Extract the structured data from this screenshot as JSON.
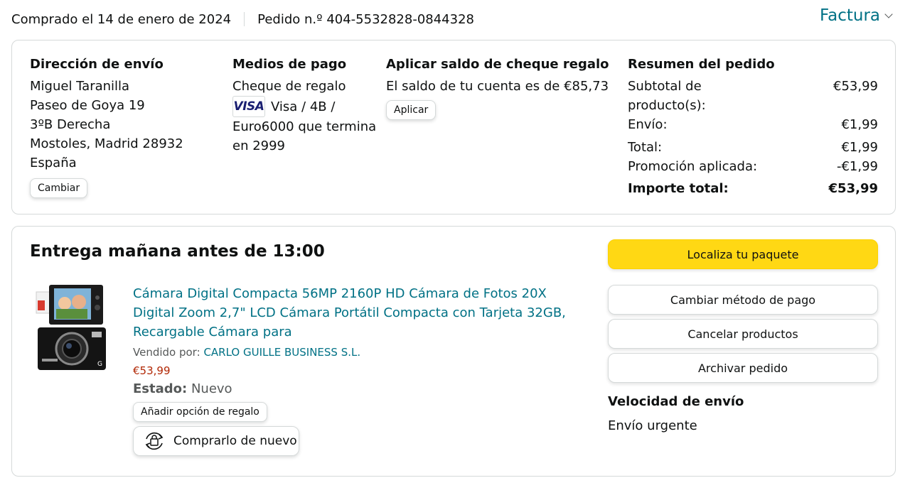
{
  "header": {
    "purchased": "Comprado el 14 de enero de 2024",
    "order_number": "Pedido n.º 404-5532828-0844328",
    "invoice": "Factura"
  },
  "shipping": {
    "heading": "Dirección de envío",
    "lines": [
      "Miguel Taranilla",
      "Paseo de Goya 19",
      "3ºB Derecha",
      "Mostoles, Madrid 28932",
      "España"
    ],
    "change_button": "Cambiar"
  },
  "payment": {
    "heading": "Medios de pago",
    "gift_card": "Cheque de regalo",
    "visa_logo": "VISA",
    "card_text": "Visa / 4B /",
    "card_text2": "Euro6000  que termina en 2999"
  },
  "gift_balance": {
    "heading": "Aplicar saldo de cheque regalo",
    "text": "El saldo de tu cuenta es de €85,73",
    "apply_button": "Aplicar"
  },
  "summary": {
    "heading": "Resumen del pedido",
    "rows": [
      {
        "label": "Subtotal de producto(s):",
        "value": "€53,99"
      },
      {
        "label": "Envío:",
        "value": "€1,99"
      },
      {
        "label": "Total:",
        "value": "€1,99"
      },
      {
        "label": "Promoción aplicada:",
        "value": "-€1,99"
      }
    ],
    "total_label": "Importe total:",
    "total_value": "€53,99"
  },
  "delivery": {
    "title": "Entrega mañana antes de 13:00",
    "product_title": "Cámara Digital Compacta 56MP 2160P HD Cámara de Fotos 20X Digital Zoom 2,7\" LCD Cámara Portátil Compacta con Tarjeta 32GB, Recargable Cámara para",
    "sold_by_label": "Vendido por:",
    "seller": "CARLO GUILLE BUSINESS S.L.",
    "price": "€53,99",
    "state_label": "Estado:",
    "state_value": "Nuevo",
    "gift_button": "Añadir opción de regalo",
    "buy_again": "Comprarlo de nuevo"
  },
  "actions": {
    "track": "Localiza tu paquete",
    "change_payment": "Cambiar método de pago",
    "cancel": "Cancelar productos",
    "archive": "Archivar pedido",
    "ship_speed_heading": "Velocidad de envío",
    "ship_speed_value": "Envío urgente"
  },
  "colors": {
    "link": "#007185",
    "price": "#b12704",
    "primary_button": "#ffd814",
    "border": "#d5d9d9"
  }
}
